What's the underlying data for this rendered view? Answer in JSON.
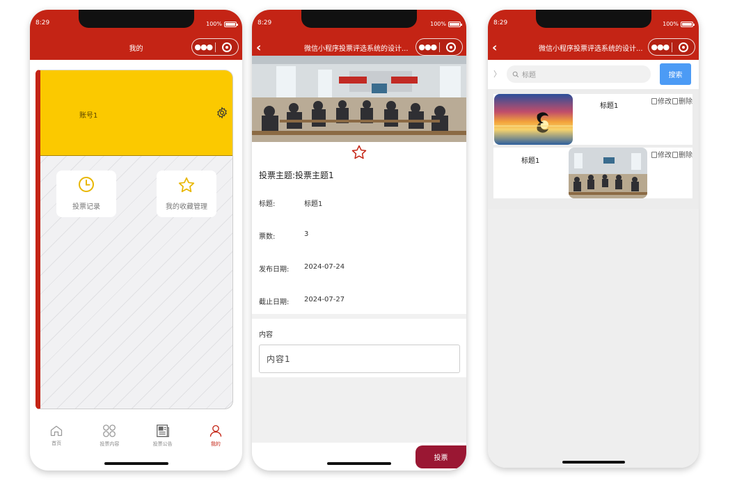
{
  "status": {
    "time": "8:29",
    "battery": "100%"
  },
  "phone1": {
    "title": "我的",
    "account": "账号1",
    "tiles": [
      {
        "label": "投票记录",
        "icon": "clock-icon"
      },
      {
        "label": "我的收藏管理",
        "icon": "star-icon"
      }
    ],
    "tabs": [
      {
        "label": "首页",
        "icon": "home-icon",
        "active": false
      },
      {
        "label": "投票内容",
        "icon": "grid-icon",
        "active": false
      },
      {
        "label": "投票公告",
        "icon": "news-icon",
        "active": false
      },
      {
        "label": "我的",
        "icon": "user-icon",
        "active": true
      }
    ]
  },
  "phone2": {
    "title": "微信小程序投票评选系统的设计...",
    "theme_label": "投票主题:",
    "theme_value": "投票主题1",
    "fields": [
      {
        "key": "标题:",
        "value": "标题1"
      },
      {
        "key": "票数:",
        "value": "3"
      },
      {
        "key": "发布日期:",
        "value": "2024-07-24"
      },
      {
        "key": "截止日期:",
        "value": "2024-07-27"
      }
    ],
    "content_label": "内容",
    "content_value": "内容1",
    "vote_button": "投票"
  },
  "phone3": {
    "title": "微信小程序投票评选系统的设计...",
    "search_placeholder": "标题",
    "search_button": "搜索",
    "items": [
      {
        "title": "标题1",
        "edit": "修改",
        "delete": "删除",
        "image": "dolphin-sunset"
      },
      {
        "title": "标题1",
        "edit": "修改",
        "delete": "删除",
        "image": "meeting-room"
      }
    ]
  },
  "colors": {
    "brand_red": "#c42415",
    "yellow": "#fbc900",
    "search_blue": "#4c9bf5",
    "vote_red": "#9a1733"
  }
}
